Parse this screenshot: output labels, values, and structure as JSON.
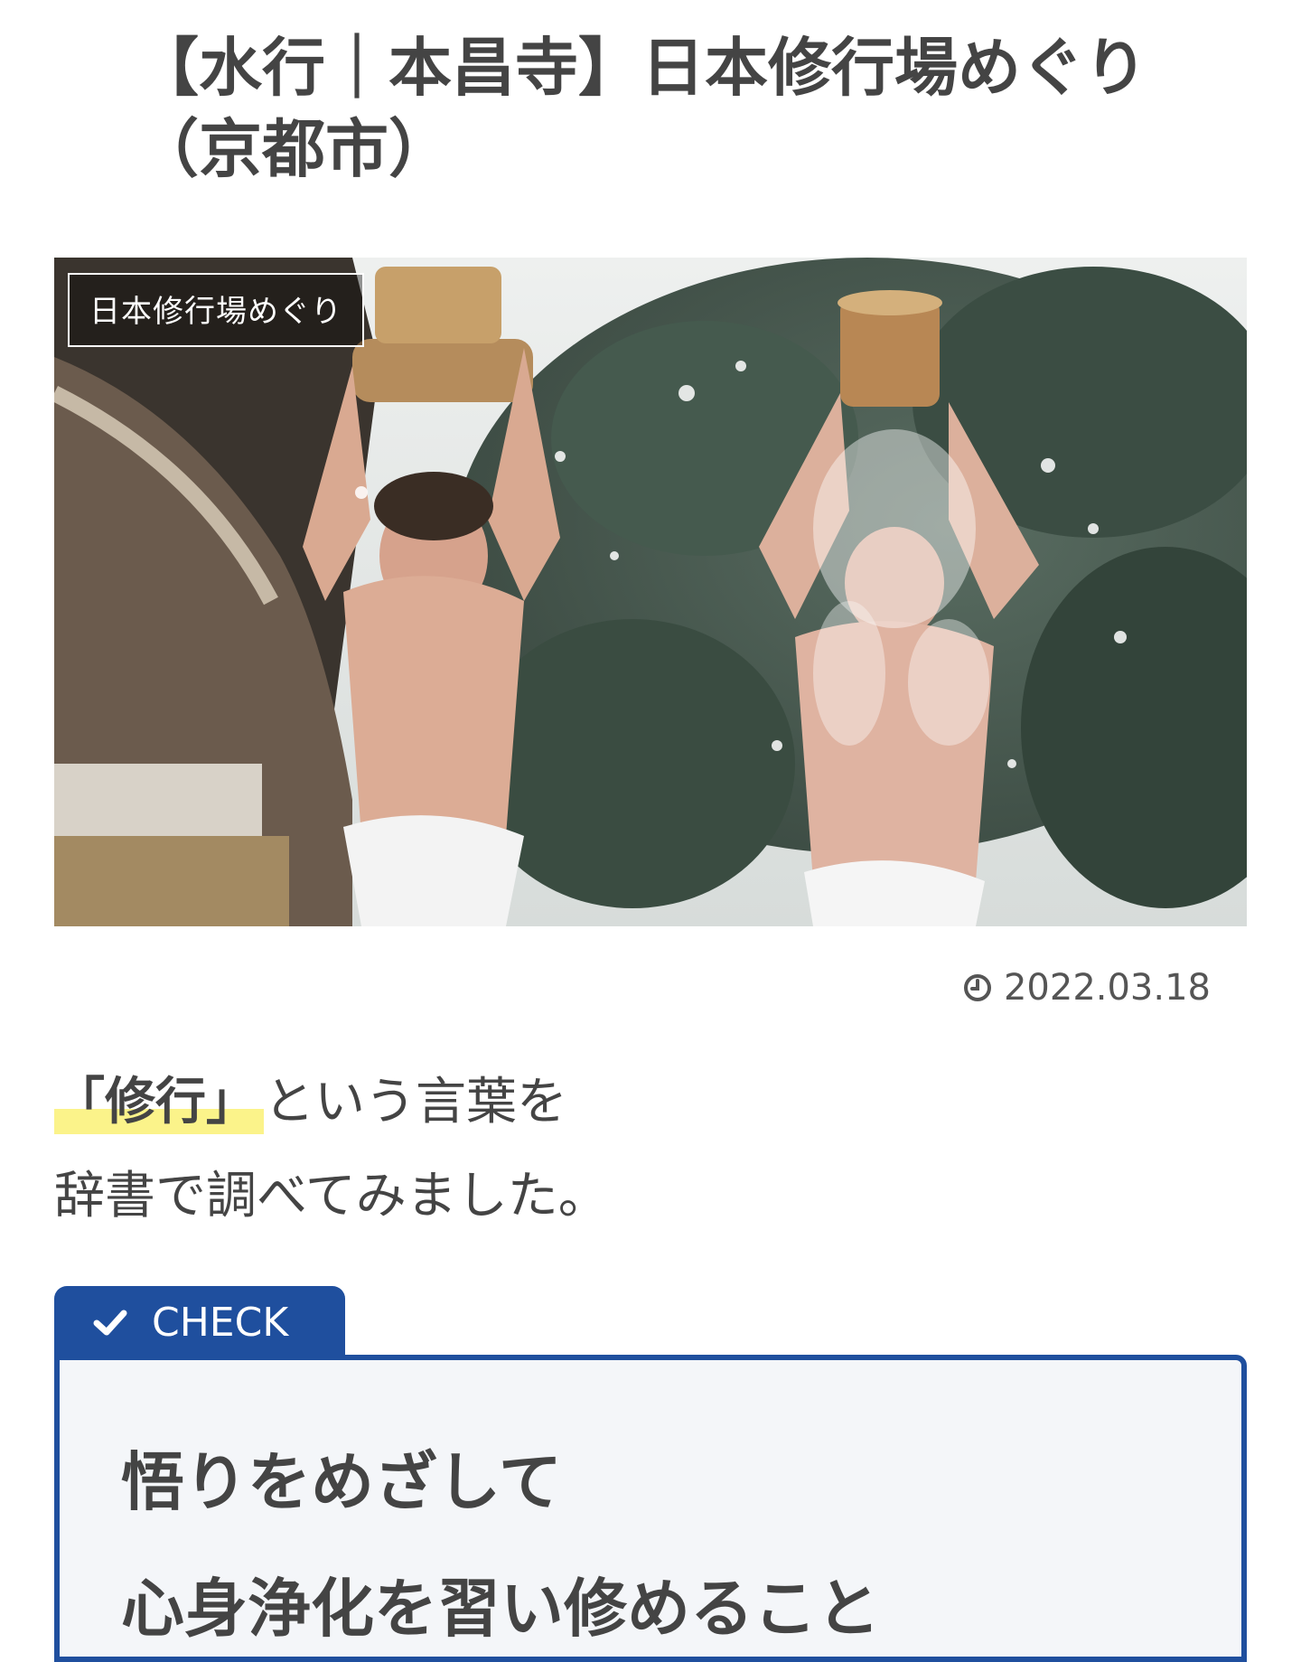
{
  "article": {
    "title": "【水行｜本昌寺】日本修行場めぐり（京都市）",
    "category_tag": "日本修行場めぐり",
    "date": "2022.03.18",
    "lead": {
      "highlight": "「修行」",
      "line1_rest": "という言葉を",
      "line2": "辞書で調べてみました。"
    },
    "check": {
      "tab_label": "CHECK",
      "lines": [
        "悟りをめざして",
        "心身浄化を習い修めること"
      ]
    }
  },
  "colors": {
    "accent_blue": "#1f4f9e",
    "marker_yellow": "#fbf38a",
    "box_background": "#f4f6f9"
  },
  "icons": {
    "date": "clock-icon",
    "check": "check-icon"
  }
}
